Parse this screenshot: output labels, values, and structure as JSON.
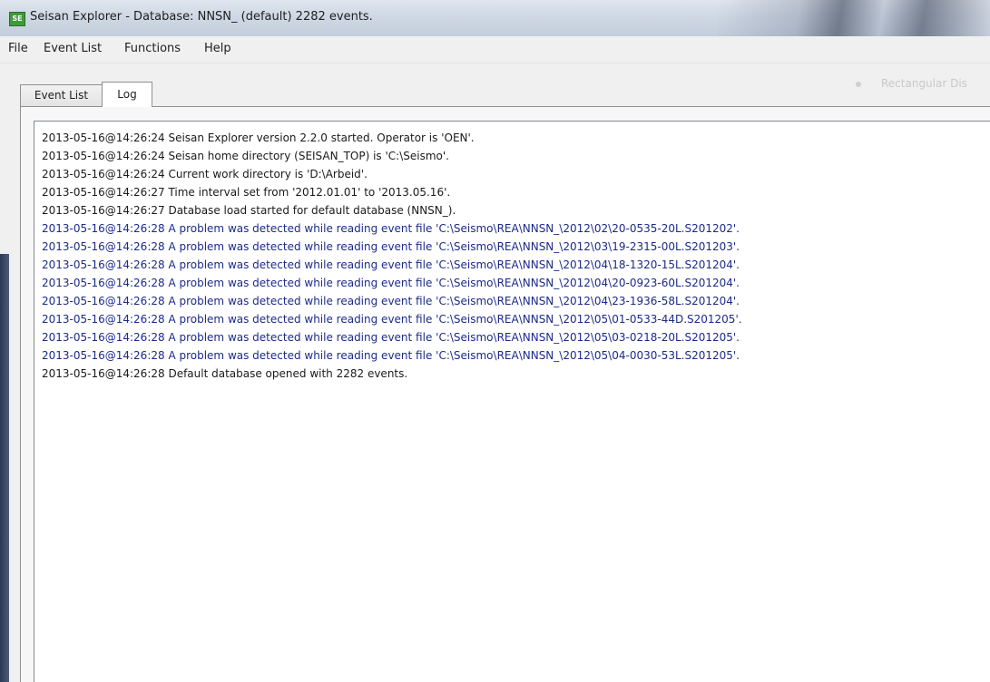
{
  "window": {
    "title": "Seisan Explorer - Database: NNSN_ (default) 2282 events.",
    "icon_label": "SE",
    "icon_name": "seisan-explorer-app-icon"
  },
  "menu": {
    "items": [
      {
        "label": "File"
      },
      {
        "label": "Event List"
      },
      {
        "label": "Functions"
      },
      {
        "label": "Help"
      }
    ]
  },
  "tabs": {
    "items": [
      {
        "label": "Event List",
        "selected": false
      },
      {
        "label": "Log",
        "selected": true
      }
    ]
  },
  "faded_option": {
    "label": "Rectangular Dis"
  },
  "log": {
    "lines": [
      {
        "text": "2013-05-16@14:26:24 Seisan Explorer version 2.2.0 started. Operator is 'OEN'.",
        "level": "info"
      },
      {
        "text": "2013-05-16@14:26:24 Seisan home directory (SEISAN_TOP) is 'C:\\Seismo'.",
        "level": "info"
      },
      {
        "text": "2013-05-16@14:26:24 Current work directory is 'D:\\Arbeid'.",
        "level": "info"
      },
      {
        "text": "2013-05-16@14:26:27 Time interval set from '2012.01.01' to '2013.05.16'.",
        "level": "info"
      },
      {
        "text": "2013-05-16@14:26:27 Database load started for default database (NNSN_).",
        "level": "info"
      },
      {
        "text": "2013-05-16@14:26:28 A problem was detected while reading event file 'C:\\Seismo\\REA\\NNSN_\\2012\\02\\20-0535-20L.S201202'.",
        "level": "warning"
      },
      {
        "text": "2013-05-16@14:26:28 A problem was detected while reading event file 'C:\\Seismo\\REA\\NNSN_\\2012\\03\\19-2315-00L.S201203'.",
        "level": "warning"
      },
      {
        "text": "2013-05-16@14:26:28 A problem was detected while reading event file 'C:\\Seismo\\REA\\NNSN_\\2012\\04\\18-1320-15L.S201204'.",
        "level": "warning"
      },
      {
        "text": "2013-05-16@14:26:28 A problem was detected while reading event file 'C:\\Seismo\\REA\\NNSN_\\2012\\04\\20-0923-60L.S201204'.",
        "level": "warning"
      },
      {
        "text": "2013-05-16@14:26:28 A problem was detected while reading event file 'C:\\Seismo\\REA\\NNSN_\\2012\\04\\23-1936-58L.S201204'.",
        "level": "warning"
      },
      {
        "text": "2013-05-16@14:26:28 A problem was detected while reading event file 'C:\\Seismo\\REA\\NNSN_\\2012\\05\\01-0533-44D.S201205'.",
        "level": "warning"
      },
      {
        "text": "2013-05-16@14:26:28 A problem was detected while reading event file 'C:\\Seismo\\REA\\NNSN_\\2012\\05\\03-0218-20L.S201205'.",
        "level": "warning"
      },
      {
        "text": "2013-05-16@14:26:28 A problem was detected while reading event file 'C:\\Seismo\\REA\\NNSN_\\2012\\05\\04-0030-53L.S201205'.",
        "level": "warning"
      },
      {
        "text": "2013-05-16@14:26:28 Default database opened with 2282 events.",
        "level": "info"
      }
    ]
  },
  "colors": {
    "info_text": "#1a1a1a",
    "warning_text": "#1c2a8a"
  }
}
